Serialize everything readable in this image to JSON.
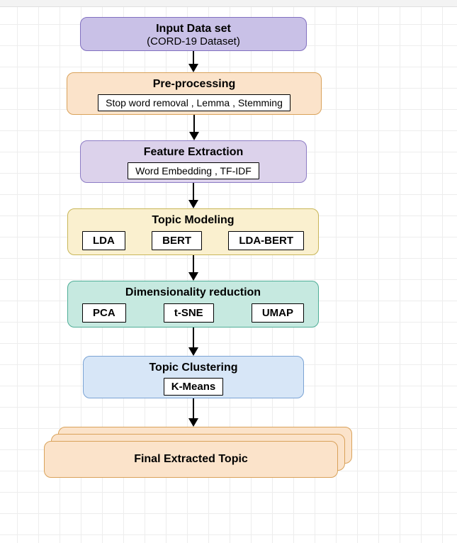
{
  "nodes": {
    "input": {
      "title": "Input Data set",
      "subtitle": "(CORD-19 Dataset)"
    },
    "preprocess": {
      "title": "Pre-processing",
      "sub": "Stop word removal , Lemma , Stemming"
    },
    "feature": {
      "title": "Feature Extraction",
      "sub": "Word Embedding  , TF-IDF"
    },
    "topic": {
      "title": "Topic Modeling",
      "items": [
        "LDA",
        "BERT",
        "LDA-BERT"
      ]
    },
    "dimred": {
      "title": "Dimensionality reduction",
      "items": [
        "PCA",
        "t-SNE",
        "UMAP"
      ]
    },
    "cluster": {
      "title": "Topic Clustering",
      "sub": "K-Means"
    },
    "final": {
      "title": "Final Extracted Topic"
    }
  }
}
